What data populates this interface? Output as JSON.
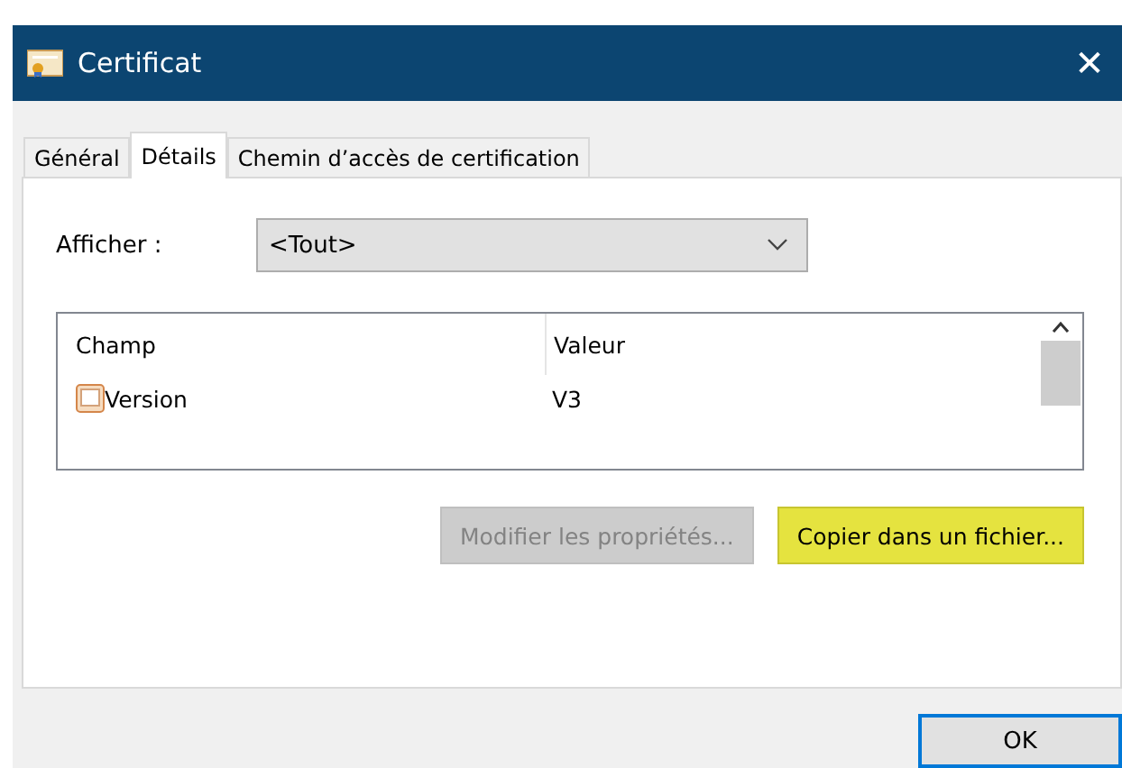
{
  "window": {
    "title": "Certificat",
    "close": "✕"
  },
  "tabs": [
    {
      "label": "Général",
      "selected": false
    },
    {
      "label": "Détails",
      "selected": true
    },
    {
      "label": "Chemin d’accès de certification",
      "selected": false
    }
  ],
  "show": {
    "label": "Afficher :",
    "value": "<Tout>"
  },
  "table": {
    "columns": [
      "Champ",
      "Valeur"
    ],
    "rows": [
      {
        "field": "Version",
        "value": "V3"
      }
    ]
  },
  "actions": [
    {
      "label": "Modifier les propriétés...",
      "disabled": true,
      "highlighted": false
    },
    {
      "label": "Copier dans un fichier...",
      "disabled": false,
      "highlighted": true
    }
  ],
  "buttons": [
    {
      "label": "OK",
      "default": true
    }
  ]
}
